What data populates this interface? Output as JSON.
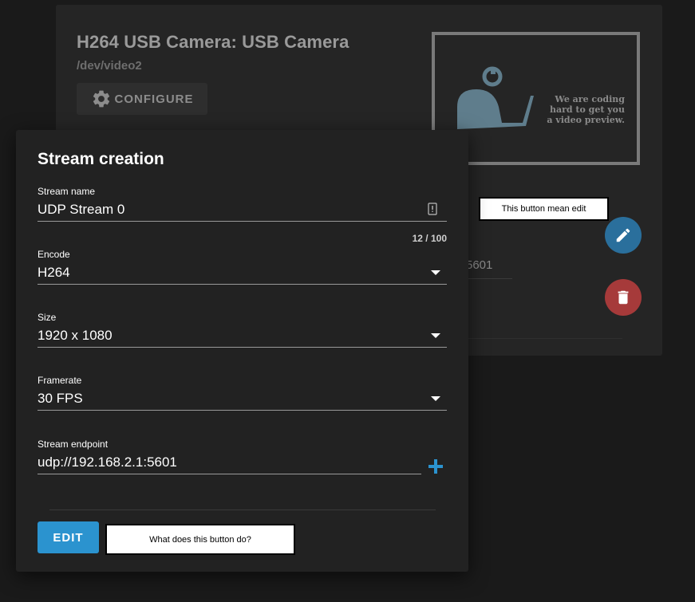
{
  "camera": {
    "title": "H264 USB Camera: USB Camera",
    "device": "/dev/video2",
    "configure_label": "CONFIGURE",
    "preview_text_line1": "We are coding",
    "preview_text_line2": "hard to get you",
    "preview_text_line3": "a video preview.",
    "endpoint_ghost": "5601"
  },
  "annotations": {
    "edit_note": "This button mean edit",
    "question_note": "What does this button do?"
  },
  "dialog": {
    "title": "Stream creation",
    "fields": {
      "stream_name": {
        "label": "Stream name",
        "value": "UDP Stream 0",
        "counter": "12 / 100"
      },
      "encode": {
        "label": "Encode",
        "value": "H264"
      },
      "size": {
        "label": "Size",
        "value": "1920 x 1080"
      },
      "framerate": {
        "label": "Framerate",
        "value": "30 FPS"
      },
      "endpoint": {
        "label": "Stream endpoint",
        "value": "udp://192.168.2.1:5601"
      }
    },
    "edit_label": "EDIT"
  },
  "colors": {
    "accent": "#2b93cf",
    "fab_edit": "#2a6f9c",
    "fab_delete": "#a63a3a",
    "background": "#1a1a1a",
    "card": "#252525",
    "dialog": "#222222"
  },
  "icons": {
    "configure": "gear-icon",
    "fab_edit": "pencil-icon",
    "fab_delete": "trash-icon",
    "dropdown": "chevron-down-icon",
    "add": "plus-icon",
    "stream_name": "badge-icon"
  }
}
